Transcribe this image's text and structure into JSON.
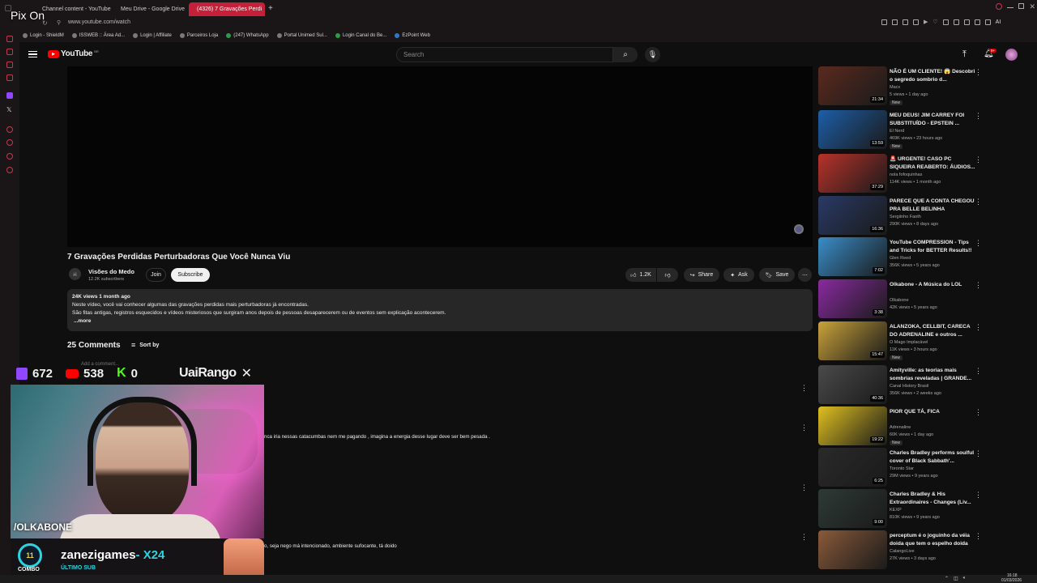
{
  "browser": {
    "tabs": [
      {
        "label": "Channel content - YouTube",
        "active": false
      },
      {
        "label": "Meu Drive - Google Drive",
        "active": false
      },
      {
        "label": "(4326) 7 Gravações Perdi",
        "active": true
      }
    ],
    "new_tab": "+",
    "url": "www.youtube.com/watch",
    "ai_label": "AI",
    "bookmarks": [
      "Login - ShieldM",
      "ISSWEB :: Área Ad...",
      "Login | Affiliate",
      "Parceiros Loja",
      "(247) WhatsApp",
      "Portal Unimed Sul...",
      "Login Canal do Be...",
      "EzPoint Web"
    ]
  },
  "overlay_top_label": "Pix On",
  "youtube": {
    "logo_text": "YouTube",
    "logo_country": "BR",
    "search_placeholder": "Search",
    "notification_badge": "9+"
  },
  "video": {
    "title": "7 Gravações Perdidas Perturbadoras Que Você Nunca Viu",
    "channel": "Visões do Medo",
    "subscribers": "12.2K subscribers",
    "join_label": "Join",
    "subscribe_label": "Subscribe",
    "likes": "1.2K",
    "share_label": "Share",
    "ask_label": "Ask",
    "save_label": "Save",
    "stats": "24K views  1 month ago",
    "description_line1": "Neste vídeo, você vai conhecer algumas das gravações perdidas mais perturbadoras já encontradas.",
    "description_line2": "São fitas antigas, registros esquecidos e vídeos misteriosos que surgiram anos depois de pessoas desaparecerem ou de eventos sem explicação acontecerem.",
    "more_label": "...more"
  },
  "comments": {
    "count_label": "25 Comments",
    "sort_label": "Sort by",
    "add_placeholder": "Add a comment...",
    "visible_texts": [
      "nca iria nessas catacumbas  nem me pagando  , imagina a energia desse lugar deve ser bem pesada .",
      "o, seja nego má intencionado, ambiente sufocante, tá doido"
    ]
  },
  "related": [
    {
      "title": "NÃO É UM CLIENTE! 😱 Descobri o segredo sombrio d...",
      "channel": "Macx",
      "meta": "5 views • 1 day ago",
      "badge": "New",
      "duration": "21:34",
      "thumb": "#5a2a1e"
    },
    {
      "title": "MEU DEUS! JIM CARREY FOI SUBSTITUÍDO - EPSTEIN ...",
      "channel": "El Nerd",
      "meta": "469K views • 23 hours ago",
      "badge": "New",
      "duration": "13:59",
      "thumb": "#1d5ea8"
    },
    {
      "title": "🚨 URGENTE! CASO PC SIQUEIRA REABERTO: ÁUDIOS...",
      "channel": "nola fofoquinhas",
      "meta": "114K views • 1 month ago",
      "badge": "",
      "duration": "37:29",
      "thumb": "#b8322a"
    },
    {
      "title": "PARECE QUE A CONTA CHEGOU PRA BELLE BELINHA",
      "channel": "Sergiinho Faoth",
      "meta": "290K views • 8 days ago",
      "badge": "",
      "duration": "16:36",
      "thumb": "#2a3a66"
    },
    {
      "title": "YouTube COMPRESSION - Tips and Tricks for BETTER Results!!",
      "channel": "Glen Reed",
      "meta": "356K views • 5 years ago",
      "badge": "",
      "duration": "7:02",
      "thumb": "#3a8ec9"
    },
    {
      "title": "Olkabone - A Música do LOL",
      "channel": "Olkabone",
      "meta": "42K views • 5 years ago",
      "badge": "",
      "duration": "3:38",
      "thumb": "#8a2aa0"
    },
    {
      "title": "ALANZOKA, CELLBIT, CARECA DO ADRENALINE e outros ...",
      "channel": "O Mago Implacável",
      "meta": "11K views • 3 hours ago",
      "badge": "New",
      "duration": "15:47",
      "thumb": "#c9a23a"
    },
    {
      "title": "Amityville: as teorias mais sombrias reveladas | GRANDE...",
      "channel": "Canal History Brasil",
      "meta": "356K views • 2 weeks ago",
      "badge": "",
      "duration": "40:36",
      "thumb": "#4a4a4a"
    },
    {
      "title": "PIOR QUE TÁ, FICA",
      "channel": "Adrenaline",
      "meta": "60K views • 1 day ago",
      "badge": "New",
      "duration": "19:22",
      "thumb": "#e0c020"
    },
    {
      "title": "Charles Bradley performs soulful cover of Black Sabbath'...",
      "channel": "Toronto Star",
      "meta": "29M views • 9 years ago",
      "badge": "",
      "duration": "6:25",
      "thumb": "#2a2a2a"
    },
    {
      "title": "Charles Bradley & His Extraordinaires - Changes (Liv...",
      "channel": "KEXP",
      "meta": "810K views • 9 years ago",
      "badge": "",
      "duration": "9:00",
      "thumb": "#2e3a36"
    },
    {
      "title": "perceptum é o joguinho da véia doida que tem o espelho doida",
      "channel": "CalangoLive",
      "meta": "27K views • 3 days ago",
      "badge": "",
      "duration": "",
      "thumb": "#8a5a3a"
    }
  ],
  "stream_overlay": {
    "twitch_count": "672",
    "youtube_count": "538",
    "kick_count": "0",
    "sponsor": "UaiRango",
    "handle": "/OLKABONE",
    "combo_label": "COMBO",
    "combo_value": "11",
    "last_sub_name": "zanezigames",
    "last_sub_mult": "- X24",
    "last_sub_label": "ÚLTIMO SUB"
  },
  "taskbar": {
    "time": "16:18",
    "date": "01/03/2026"
  },
  "colors": {
    "accent": "#c4203a",
    "youtube_red": "#ff0000",
    "background": "#0f0f0f"
  }
}
